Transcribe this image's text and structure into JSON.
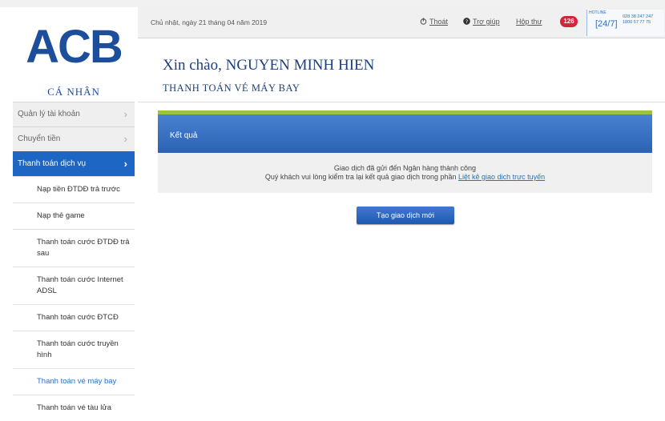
{
  "logo": {
    "text": "ACB",
    "subtitle": "CÁ NHÂN"
  },
  "header": {
    "date": "Chủ nhật, ngày 21 tháng 04 năm 2019",
    "logout_label": "Thoát",
    "help_label": "Trợ giúp",
    "inbox_label": "Hộp thư",
    "inbox_count": "126",
    "hotline_label": "[24/7]",
    "hotline_top": "HOTLINE",
    "hotline_numbers": [
      "028 38 247 247",
      "1800 57 77 75"
    ]
  },
  "greeting": "Xin chào, NGUYEN MINH HIEN",
  "page_title": "THANH TOÁN VÉ MÁY BAY",
  "sidebar": {
    "items": [
      {
        "label": "Quản lý tài khoản"
      },
      {
        "label": "Chuyển tiền"
      },
      {
        "label": "Thanh toán dịch vụ"
      }
    ],
    "sub_items": [
      {
        "label": "Nạp tiền ĐTDĐ trả trước"
      },
      {
        "label": "Nạp thẻ game"
      },
      {
        "label": "Thanh toán cước ĐTDĐ trả sau"
      },
      {
        "label": "Thanh toán cước Internet ADSL"
      },
      {
        "label": "Thanh toán cước ĐTCĐ"
      },
      {
        "label": "Thanh toán cước truyền hình"
      },
      {
        "label": "Thanh toán vé máy bay"
      },
      {
        "label": "Thanh toán vé tàu lửa"
      }
    ]
  },
  "result": {
    "title": "Kết quả",
    "line1": "Giao dịch đã gửi đến Ngân hàng thành công",
    "line2": "Quý khách vui lòng kiểm tra lại kết quả giao dịch trong phần",
    "link": "Liệt kê giao dịch trực tuyến"
  },
  "new_button": "Tạo giao dịch mới",
  "colors": {
    "brand": "#1d4e9c",
    "active": "#1e66c3",
    "accent": "#9ec33b",
    "badge": "#d4243a"
  }
}
